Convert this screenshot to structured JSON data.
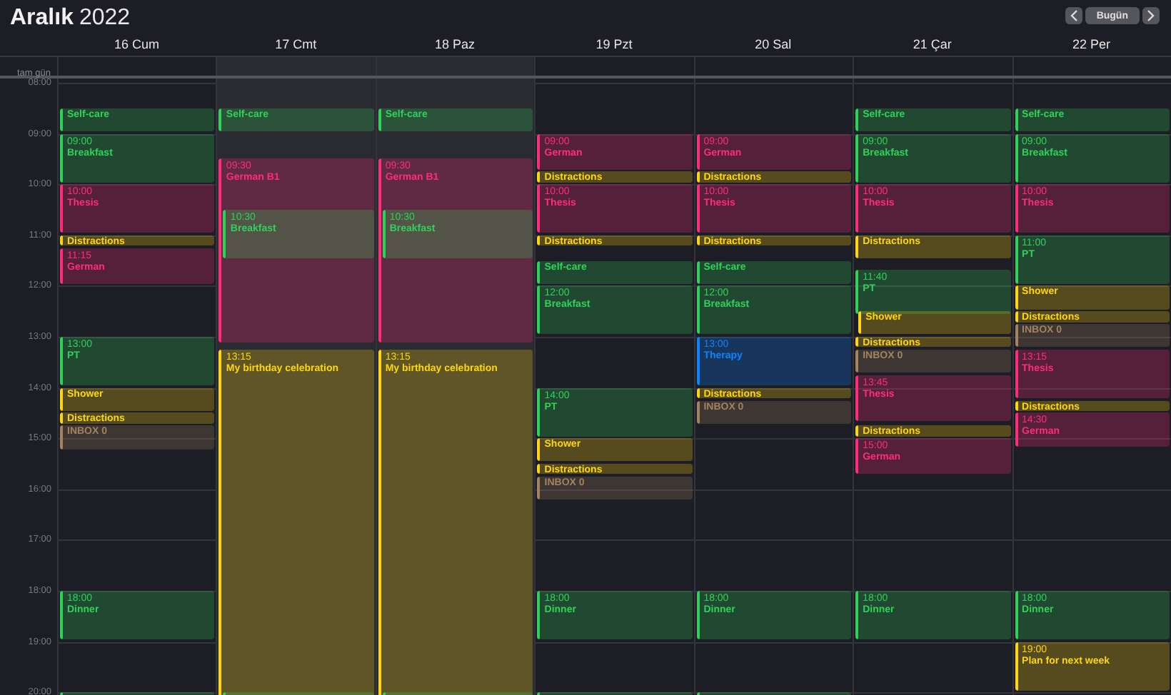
{
  "header": {
    "month": "Aralık",
    "year": "2022",
    "today_button": "Bugün"
  },
  "all_day_label": "tam gün",
  "hours": [
    "08:00",
    "09:00",
    "10:00",
    "11:00",
    "12:00",
    "13:00",
    "14:00",
    "15:00",
    "16:00",
    "17:00",
    "18:00",
    "19:00",
    "20:00"
  ],
  "days": [
    {
      "label": "16 Cum",
      "weekend": false,
      "events": [
        {
          "title": "Self-care",
          "color": "#30d158"
        },
        {
          "time": "09:00",
          "title": "Breakfast",
          "color": "#30d158"
        },
        {
          "time": "10:00",
          "title": "Thesis",
          "color": "#ff2d78"
        },
        {
          "title": "Distractions",
          "color": "#ffd60a"
        },
        {
          "time": "11:15",
          "title": "German",
          "color": "#ff2d78"
        },
        {
          "time": "13:00",
          "title": "PT",
          "color": "#30d158"
        },
        {
          "title": "Shower",
          "color": "#ffd60a"
        },
        {
          "title": "Distractions",
          "color": "#ffd60a"
        },
        {
          "title": "INBOX 0",
          "color": "#a2845e"
        },
        {
          "time": "18:00",
          "title": "Dinner",
          "color": "#30d158"
        },
        {
          "color": "#30d158"
        }
      ]
    },
    {
      "label": "17 Cmt",
      "weekend": true,
      "events": [
        {
          "title": "Self-care",
          "color": "#30d158"
        },
        {
          "time": "09:30",
          "title": "German B1",
          "color": "#ff2d78"
        },
        {
          "time": "10:30",
          "title": "Breakfast",
          "color": "#30d158"
        },
        {
          "time": "13:15",
          "title": "My birthday celebration",
          "color": "#ffd60a"
        },
        {
          "color": "#30d158"
        }
      ]
    },
    {
      "label": "18 Paz",
      "weekend": true,
      "events": [
        {
          "title": "Self-care",
          "color": "#30d158"
        },
        {
          "time": "09:30",
          "title": "German B1",
          "color": "#ff2d78"
        },
        {
          "time": "10:30",
          "title": "Breakfast",
          "color": "#30d158"
        },
        {
          "time": "13:15",
          "title": "My birthday celebration",
          "color": "#ffd60a"
        },
        {
          "color": "#30d158"
        }
      ]
    },
    {
      "label": "19 Pzt",
      "weekend": false,
      "events": [
        {
          "time": "09:00",
          "title": "German",
          "color": "#ff2d78"
        },
        {
          "title": "Distractions",
          "color": "#ffd60a"
        },
        {
          "time": "10:00",
          "title": "Thesis",
          "color": "#ff2d78"
        },
        {
          "title": "Distractions",
          "color": "#ffd60a"
        },
        {
          "title": "Self-care",
          "color": "#30d158"
        },
        {
          "time": "12:00",
          "title": "Breakfast",
          "color": "#30d158"
        },
        {
          "time": "14:00",
          "title": "PT",
          "color": "#30d158"
        },
        {
          "title": "Shower",
          "color": "#ffd60a"
        },
        {
          "title": "Distractions",
          "color": "#ffd60a"
        },
        {
          "title": "INBOX 0",
          "color": "#a2845e"
        },
        {
          "time": "18:00",
          "title": "Dinner",
          "color": "#30d158"
        },
        {
          "color": "#30d158"
        }
      ]
    },
    {
      "label": "20 Sal",
      "weekend": false,
      "events": [
        {
          "time": "09:00",
          "title": "German",
          "color": "#ff2d78"
        },
        {
          "title": "Distractions",
          "color": "#ffd60a"
        },
        {
          "time": "10:00",
          "title": "Thesis",
          "color": "#ff2d78"
        },
        {
          "title": "Distractions",
          "color": "#ffd60a"
        },
        {
          "title": "Self-care",
          "color": "#30d158"
        },
        {
          "time": "12:00",
          "title": "Breakfast",
          "color": "#30d158"
        },
        {
          "time": "13:00",
          "title": "Therapy",
          "color": "#0a84ff"
        },
        {
          "title": "Distractions",
          "color": "#ffd60a"
        },
        {
          "title": "INBOX 0",
          "color": "#a2845e"
        },
        {
          "time": "18:00",
          "title": "Dinner",
          "color": "#30d158"
        },
        {
          "color": "#30d158"
        }
      ]
    },
    {
      "label": "21 Çar",
      "weekend": false,
      "events": [
        {
          "title": "Self-care",
          "color": "#30d158"
        },
        {
          "time": "09:00",
          "title": "Breakfast",
          "color": "#30d158"
        },
        {
          "time": "10:00",
          "title": "Thesis",
          "color": "#ff2d78"
        },
        {
          "title": "Distractions",
          "color": "#ffd60a"
        },
        {
          "time": "11:40",
          "title": "PT",
          "color": "#30d158"
        },
        {
          "title": "Shower",
          "color": "#ffd60a"
        },
        {
          "title": "Distractions",
          "color": "#ffd60a"
        },
        {
          "title": "INBOX 0",
          "color": "#a2845e"
        },
        {
          "time": "13:45",
          "title": "Thesis",
          "color": "#ff2d78"
        },
        {
          "title": "Distractions",
          "color": "#ffd60a"
        },
        {
          "time": "15:00",
          "title": "German",
          "color": "#ff2d78"
        },
        {
          "time": "18:00",
          "title": "Dinner",
          "color": "#30d158"
        }
      ]
    },
    {
      "label": "22 Per",
      "weekend": false,
      "events": [
        {
          "title": "Self-care",
          "color": "#30d158"
        },
        {
          "time": "09:00",
          "title": "Breakfast",
          "color": "#30d158"
        },
        {
          "time": "10:00",
          "title": "Thesis",
          "color": "#ff2d78"
        },
        {
          "time": "11:00",
          "title": "PT",
          "color": "#30d158"
        },
        {
          "title": "Shower",
          "color": "#ffd60a"
        },
        {
          "title": "Distractions",
          "color": "#ffd60a"
        },
        {
          "title": "INBOX 0",
          "color": "#a2845e"
        },
        {
          "time": "13:15",
          "title": "Thesis",
          "color": "#ff2d78"
        },
        {
          "title": "Distractions",
          "color": "#ffd60a"
        },
        {
          "time": "14:30",
          "title": "German",
          "color": "#ff2d78"
        },
        {
          "time": "18:00",
          "title": "Dinner",
          "color": "#30d158"
        },
        {
          "time": "19:00",
          "title": "Plan for next week",
          "color": "#ffd60a"
        }
      ]
    }
  ]
}
